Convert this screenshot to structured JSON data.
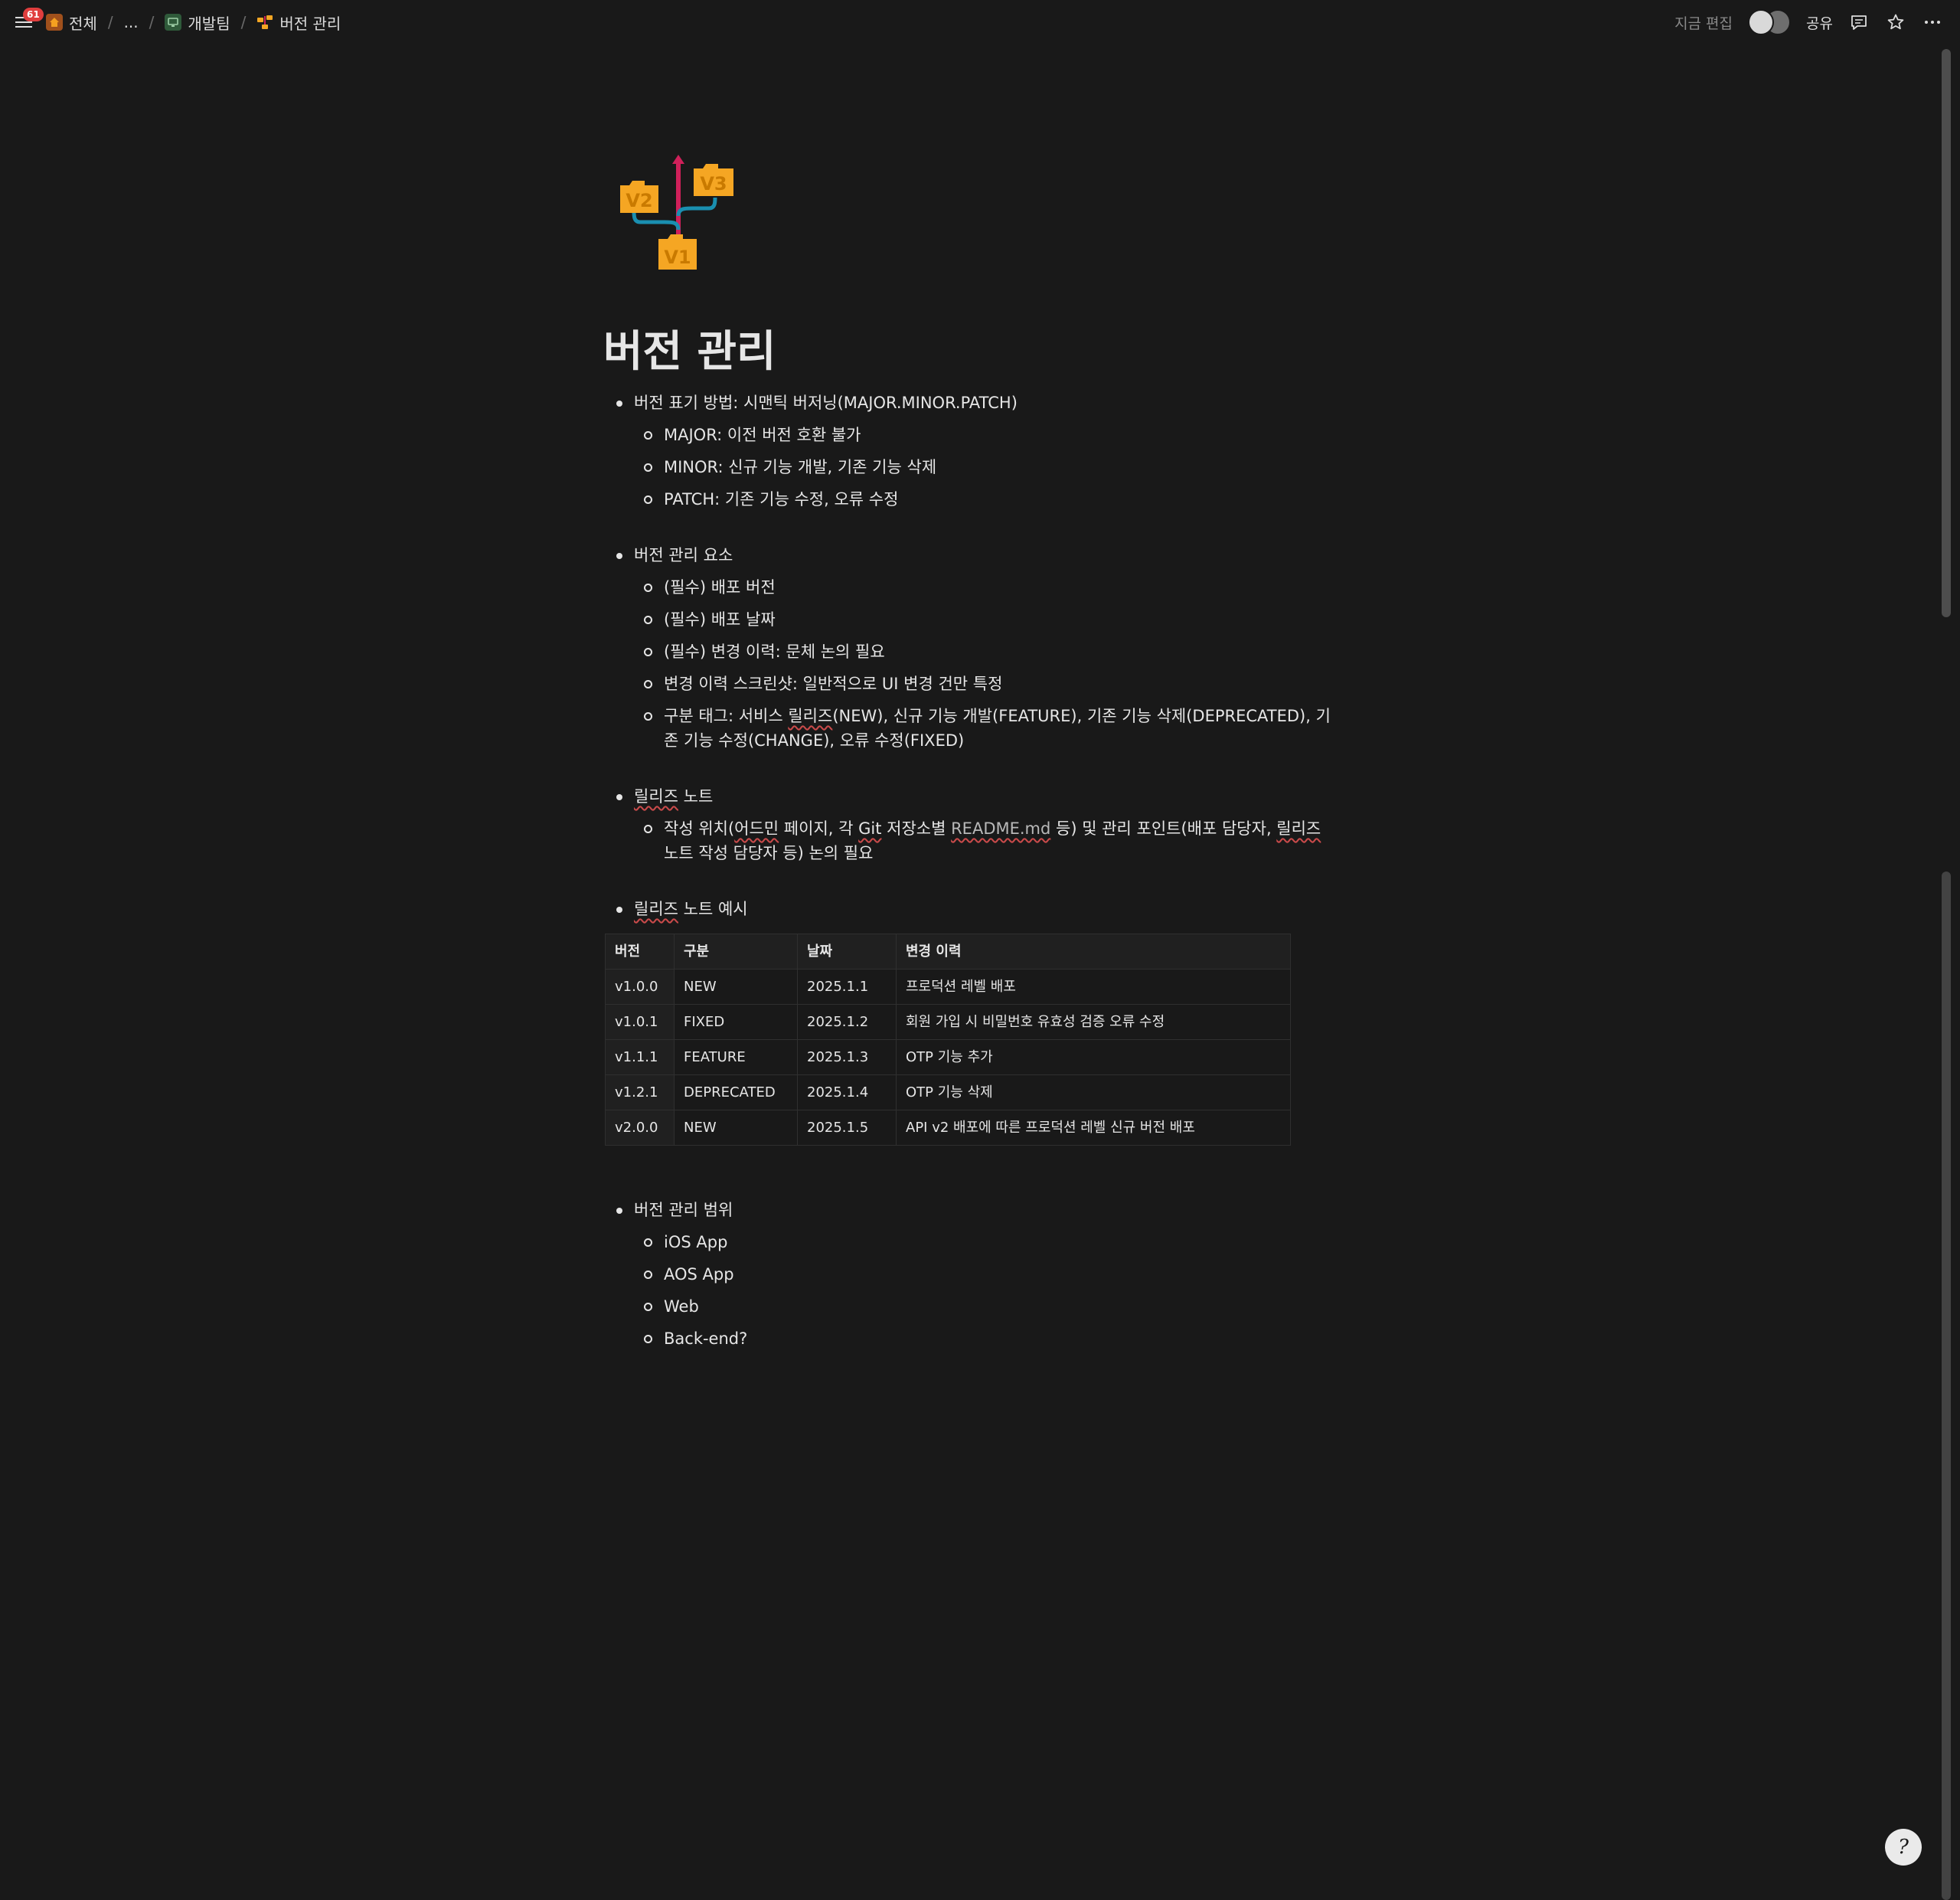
{
  "topbar": {
    "notification_count": "61",
    "breadcrumbs": [
      {
        "label": "전체"
      },
      {
        "label": "..."
      },
      {
        "label": "개발팀"
      },
      {
        "label": "버전 관리"
      }
    ],
    "separator": "/",
    "edited_status": "지금 편집",
    "share_label": "공유"
  },
  "page": {
    "title": "버전 관리",
    "icon_labels": {
      "v1": "V1",
      "v2": "V2",
      "v3": "V3"
    }
  },
  "sections": {
    "s1": {
      "heading": "버전 표기 방법: 시맨틱 버저닝(MAJOR.MINOR.PATCH)",
      "items": [
        "MAJOR: 이전 버전 호환 불가",
        "MINOR: 신규 기능 개발, 기존 기능 삭제",
        "PATCH: 기존 기능 수정, 오류 수정"
      ]
    },
    "s2": {
      "heading": "버전 관리 요소",
      "items": [
        "(필수) 배포 버전",
        "(필수) 배포 날짜",
        "(필수) 변경 이력: 문체 논의 필요",
        "변경 이력 스크린샷: 일반적으로 UI 변경 건만 특정"
      ],
      "tag_item": {
        "prefix": "구분 태그: 서비스 ",
        "word": "릴리즈",
        "suffix": "(NEW), 신규 기능 개발(FEATURE), 기존 기능 삭제(DEPRECATED), 기존 기능 수정(CHANGE), 오류 수정(FIXED)"
      }
    },
    "s3": {
      "heading_word": "릴리즈",
      "heading_suffix": " 노트",
      "item": {
        "p1": "작성 위치(",
        "w1": "어드민",
        "p2": " 페이지, 각 ",
        "w2": "Git",
        "p3": " 저장소별 ",
        "w3": "README.md",
        "p4": " 등) 및 관리 포인트(배포 담당자, ",
        "w4": "릴리즈",
        "p5": " 노트 작성 담당자 등) 논의 필요"
      }
    },
    "s4": {
      "heading_word": "릴리즈",
      "heading_suffix": " 노트 예시",
      "table": {
        "headers": [
          "버전",
          "구분",
          "날짜",
          "변경 이력"
        ],
        "rows": [
          [
            "v1.0.0",
            "NEW",
            "2025.1.1",
            "프로덕션 레벨 배포"
          ],
          [
            "v1.0.1",
            "FIXED",
            "2025.1.2",
            "회원 가입 시 비밀번호 유효성 검증 오류 수정"
          ],
          [
            "v1.1.1",
            "FEATURE",
            "2025.1.3",
            "OTP 기능 추가"
          ],
          [
            "v1.2.1",
            "DEPRECATED",
            "2025.1.4",
            "OTP 기능 삭제"
          ],
          [
            "v2.0.0",
            "NEW",
            "2025.1.5",
            "API v2 배포에 따른 프로덕션 레벨 신규 버전 배포"
          ]
        ]
      }
    },
    "s5": {
      "heading": "버전 관리 범위",
      "items": [
        "iOS App",
        "AOS App",
        "Web",
        "Back-end?"
      ]
    }
  },
  "help_glyph": "?"
}
